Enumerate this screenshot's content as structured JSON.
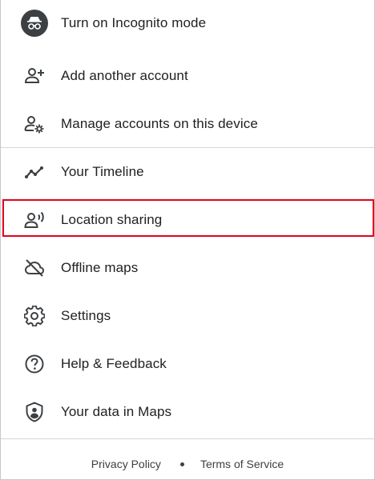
{
  "menu": {
    "items": [
      {
        "label": "Turn on Incognito mode",
        "icon": "incognito-icon"
      },
      {
        "label": "Add another account",
        "icon": "add-person-icon"
      },
      {
        "label": "Manage accounts on this device",
        "icon": "manage-accounts-icon"
      },
      {
        "label": "Your Timeline",
        "icon": "timeline-icon"
      },
      {
        "label": "Location sharing",
        "icon": "location-sharing-icon"
      },
      {
        "label": "Offline maps",
        "icon": "offline-cloud-icon"
      },
      {
        "label": "Settings",
        "icon": "gear-icon"
      },
      {
        "label": "Help & Feedback",
        "icon": "help-icon"
      },
      {
        "label": "Your data in Maps",
        "icon": "shield-person-icon"
      }
    ]
  },
  "highlight": {
    "target": "Location sharing",
    "color": "#e3001b"
  },
  "footer": {
    "privacy": "Privacy Policy",
    "terms": "Terms of Service"
  }
}
